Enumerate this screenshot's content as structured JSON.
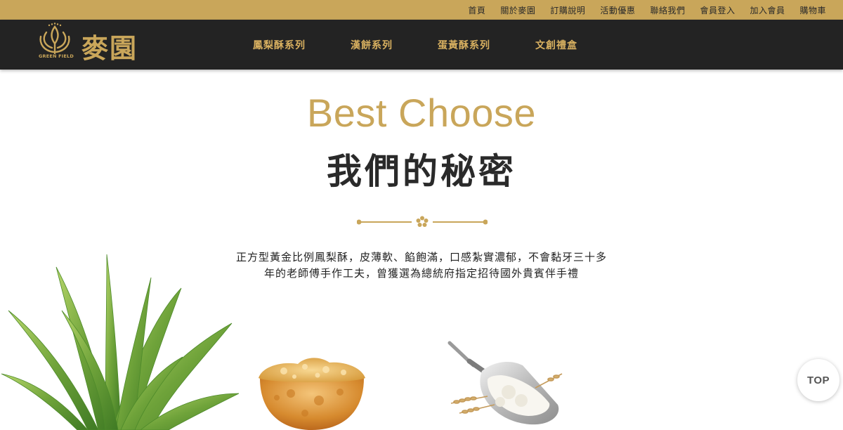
{
  "topbar": {
    "links": [
      "首頁",
      "關於麥園",
      "訂購說明",
      "活動優惠",
      "聯絡我們",
      "會員登入",
      "加入會員",
      "購物車"
    ]
  },
  "brand": {
    "name_zh": "麥園",
    "name_en": "GREEN FIELD",
    "icon": "wheat-crown-logo"
  },
  "nav": {
    "items": [
      "鳳梨酥系列",
      "漢餅系列",
      "蛋黃酥系列",
      "文創禮盒"
    ]
  },
  "hero": {
    "eyebrow": "Best Choose",
    "title": "我們的秘密",
    "description_line1": "正方型黃金比例鳳梨酥，皮薄軟、餡飽滿，口感紮實濃郁，不會黏牙三十多",
    "description_line2": "年的老師傅手作工夫，曾獲選為總統府指定招待國外貴賓伴手禮"
  },
  "back_to_top": "TOP",
  "colors": {
    "gold": "#c9a65a",
    "nav_bg": "#232323",
    "text_dark": "#2a2a2a"
  }
}
